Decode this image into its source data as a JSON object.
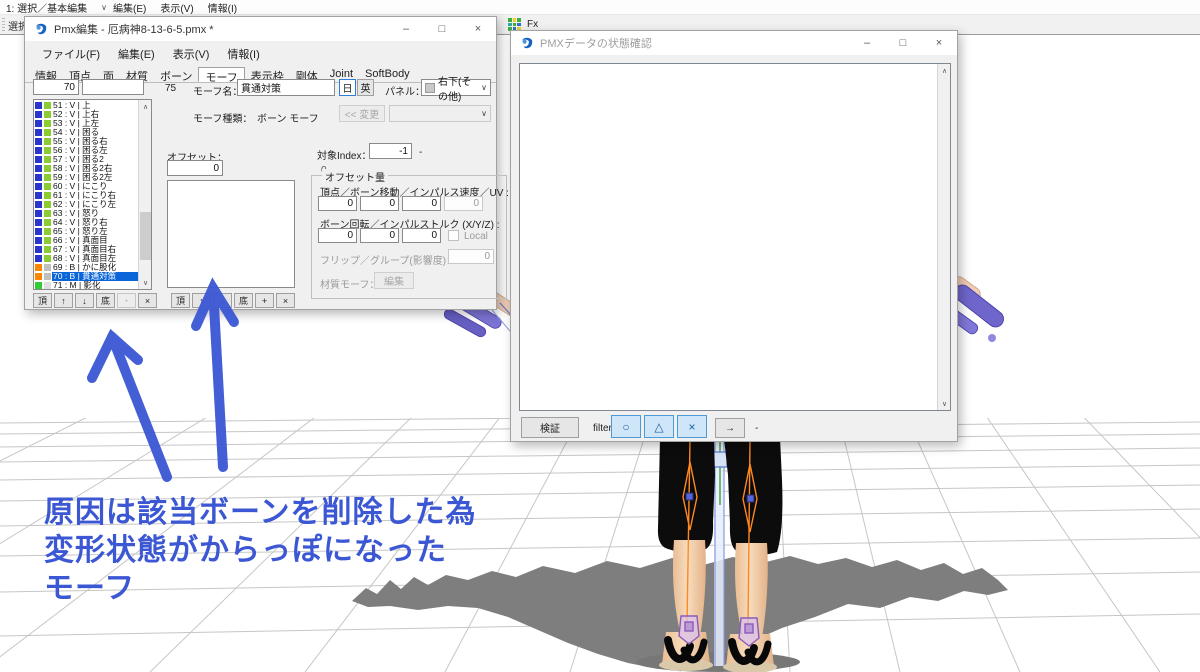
{
  "menubar": {
    "mode_select": "1: 選択／基本編集",
    "mode_caret": "∨",
    "items": [
      "編集(E)",
      "表示(V)",
      "情報(I)"
    ],
    "left_tool_label": "選択"
  },
  "viewport": {
    "fx_label": "Fx"
  },
  "window_controls": {
    "min": "–",
    "max": "□",
    "close": "×"
  },
  "scroll": {
    "up": "∧",
    "down": "∨"
  },
  "pmx_window": {
    "title": "Pmx編集 - 厄病神8-13-6-5.pmx *",
    "menu": [
      "ファイル(F)",
      "編集(E)",
      "表示(V)",
      "情報(I)"
    ],
    "tabs": [
      "情報",
      "頂点",
      "面",
      "材質",
      "ボーン",
      "モーフ",
      "表示枠",
      "剛体",
      "Joint",
      "SoftBody"
    ],
    "active_tab": "モーフ",
    "index_value": "70",
    "index_value2": "",
    "count_label": "75",
    "morph_name_label": "モーフ名：",
    "morph_name": "貫通対策",
    "jp_button": "日",
    "en_button": "英",
    "panel_label": "パネル：",
    "panel_value": "右下(その他)",
    "panel_caret": "∨",
    "morph_type_label": "モーフ種類：",
    "morph_type_value": "ボーン モーフ",
    "change_button": "<< 変更",
    "offset_label": "オフセット：",
    "offset_index_value": "0",
    "offset_count": "0",
    "target_index_label": "対象Index：",
    "target_index_value": "-1",
    "target_index_suffix": "-",
    "offset_group_title": "オフセット量",
    "row1_label": "頂点／ボーン移動／インパルス速度／UV :",
    "row1_values": [
      "0",
      "0",
      "0",
      "0"
    ],
    "row2_label": "ボーン回転／インパルストルク (X/Y/Z) :",
    "row2_values": [
      "0",
      "0",
      "0"
    ],
    "local_label": "Local",
    "row3_label": "フリップ／グループ(影響度)：",
    "row3_value": "0",
    "material_morph_label": "材質モーフ：",
    "edit_button": "編集",
    "list_buttons": [
      "頂",
      "↑",
      "↓",
      "底",
      "・",
      "×"
    ],
    "offset_list_buttons": [
      "頂",
      "↑",
      "↓",
      "底",
      "+",
      "×"
    ],
    "morph_colors": {
      "v1": "#2a35cc",
      "v2": "#8ccc33",
      "b1": "#ff8800",
      "b2": "#c0c0c0",
      "m1": "#33cc33",
      "m2": "#e0e0e0"
    },
    "morphs": [
      {
        "n": "51",
        "t": "V",
        "label": "上",
        "c1": "#2a35cc",
        "c2": "#8ccc33",
        "sel": false
      },
      {
        "n": "52",
        "t": "V",
        "label": "上右",
        "c1": "#2a35cc",
        "c2": "#8ccc33",
        "sel": false
      },
      {
        "n": "53",
        "t": "V",
        "label": "上左",
        "c1": "#2a35cc",
        "c2": "#8ccc33",
        "sel": false
      },
      {
        "n": "54",
        "t": "V",
        "label": "困る",
        "c1": "#2a35cc",
        "c2": "#8ccc33",
        "sel": false
      },
      {
        "n": "55",
        "t": "V",
        "label": "困る右",
        "c1": "#2a35cc",
        "c2": "#8ccc33",
        "sel": false
      },
      {
        "n": "56",
        "t": "V",
        "label": "困る左",
        "c1": "#2a35cc",
        "c2": "#8ccc33",
        "sel": false
      },
      {
        "n": "57",
        "t": "V",
        "label": "困る2",
        "c1": "#2a35cc",
        "c2": "#8ccc33",
        "sel": false
      },
      {
        "n": "58",
        "t": "V",
        "label": "困る2右",
        "c1": "#2a35cc",
        "c2": "#8ccc33",
        "sel": false
      },
      {
        "n": "59",
        "t": "V",
        "label": "困る2左",
        "c1": "#2a35cc",
        "c2": "#8ccc33",
        "sel": false
      },
      {
        "n": "60",
        "t": "V",
        "label": "にこり",
        "c1": "#2a35cc",
        "c2": "#8ccc33",
        "sel": false
      },
      {
        "n": "61",
        "t": "V",
        "label": "にこり右",
        "c1": "#2a35cc",
        "c2": "#8ccc33",
        "sel": false
      },
      {
        "n": "62",
        "t": "V",
        "label": "にこり左",
        "c1": "#2a35cc",
        "c2": "#8ccc33",
        "sel": false
      },
      {
        "n": "63",
        "t": "V",
        "label": "怒り",
        "c1": "#2a35cc",
        "c2": "#8ccc33",
        "sel": false
      },
      {
        "n": "64",
        "t": "V",
        "label": "怒り右",
        "c1": "#2a35cc",
        "c2": "#8ccc33",
        "sel": false
      },
      {
        "n": "65",
        "t": "V",
        "label": "怒り左",
        "c1": "#2a35cc",
        "c2": "#8ccc33",
        "sel": false
      },
      {
        "n": "66",
        "t": "V",
        "label": "真面目",
        "c1": "#2a35cc",
        "c2": "#8ccc33",
        "sel": false
      },
      {
        "n": "67",
        "t": "V",
        "label": "真面目右",
        "c1": "#2a35cc",
        "c2": "#8ccc33",
        "sel": false
      },
      {
        "n": "68",
        "t": "V",
        "label": "真面目左",
        "c1": "#2a35cc",
        "c2": "#8ccc33",
        "sel": false
      },
      {
        "n": "69",
        "t": "B",
        "label": "かに股化",
        "c1": "#ff8800",
        "c2": "#c0c0c0",
        "sel": false
      },
      {
        "n": "70",
        "t": "B",
        "label": "貫通対策",
        "c1": "#ff8800",
        "c2": "#c0c0c0",
        "sel": true
      },
      {
        "n": "71",
        "t": "M",
        "label": "影化",
        "c1": "#33cc33",
        "c2": "#e0e0e0",
        "sel": false
      }
    ]
  },
  "state_window": {
    "title": "PMXデータの状態確認",
    "verify_button": "検証",
    "filter_label": "filter:",
    "filter_buttons": [
      "○",
      "△",
      "×"
    ],
    "arrow_button": "→",
    "suffix": "-"
  },
  "annotation": {
    "color": "#3b57d4",
    "lines": [
      "原因は該当ボーンを削除した為",
      "変形状態がからっぽになった",
      "モーフ"
    ]
  }
}
